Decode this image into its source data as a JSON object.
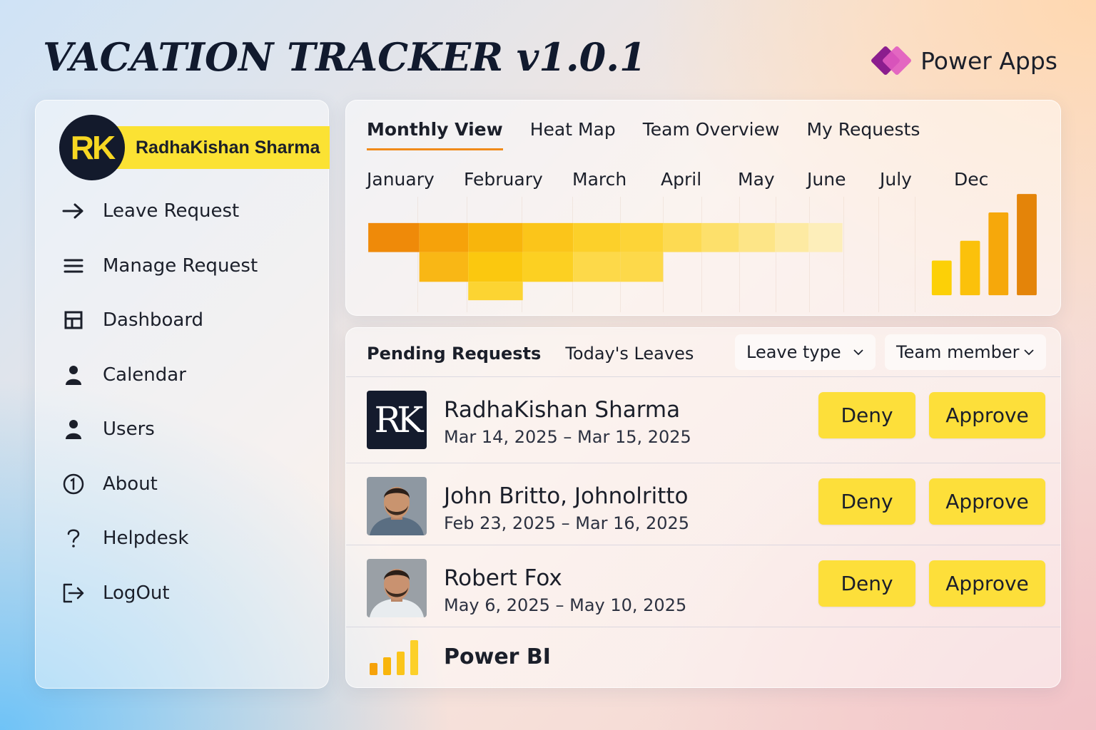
{
  "app": {
    "title": "VACATION TRACKER v1.0.1",
    "brand_label": "Power Apps"
  },
  "colors": {
    "accent_yellow": "#fddf3a",
    "tab_underline": "#f08a1a",
    "avatar_dark": "#131a2c",
    "brand_purple": "#8b1d8e",
    "brand_pink": "#e05ac0"
  },
  "sidebar": {
    "user": {
      "initials": "RK",
      "name": "RadhaKishan Sharma"
    },
    "items": [
      {
        "label": "Leave Request",
        "icon": "arrow-right-icon"
      },
      {
        "label": "Manage Request",
        "icon": "menu-icon"
      },
      {
        "label": "Dashboard",
        "icon": "grid-icon"
      },
      {
        "label": "Calendar",
        "icon": "person-icon"
      },
      {
        "label": "Users",
        "icon": "person-icon"
      },
      {
        "label": "About",
        "icon": "info-circle-icon"
      },
      {
        "label": "Helpdesk",
        "icon": "question-icon"
      },
      {
        "label": "LogOut",
        "icon": "logout-icon"
      }
    ]
  },
  "top_panel": {
    "tabs": [
      {
        "label": "Monthly View",
        "active": true
      },
      {
        "label": "Heat Map",
        "active": false
      },
      {
        "label": "Team Overview",
        "active": false
      },
      {
        "label": "My Requests",
        "active": false
      }
    ],
    "months": [
      "January",
      "February",
      "March",
      "April",
      "May",
      "June",
      "July",
      "Dec"
    ]
  },
  "bottom_panel": {
    "tabs": [
      {
        "label": "Pending Requests",
        "active": true
      },
      {
        "label": "Today's Leaves",
        "active": false
      }
    ],
    "filters": {
      "leave_type": "Leave type",
      "team_member": "Team member"
    },
    "requests": [
      {
        "name": "RadhaKishan Sharma",
        "dates": "Mar 14, 2025 – Mar 15, 2025",
        "avatar": "RK",
        "deny": "Deny",
        "approve": "Approve"
      },
      {
        "name": "John Britto, Johnolritto",
        "dates": "Feb 23, 2025 – Mar 16, 2025",
        "avatar": "photo",
        "deny": "Deny",
        "approve": "Approve"
      },
      {
        "name": "Robert Fox",
        "dates": "May 6, 2025 – May 10, 2025",
        "avatar": "photo",
        "deny": "Deny",
        "approve": "Approve"
      }
    ],
    "footer_label": "Power BI"
  }
}
